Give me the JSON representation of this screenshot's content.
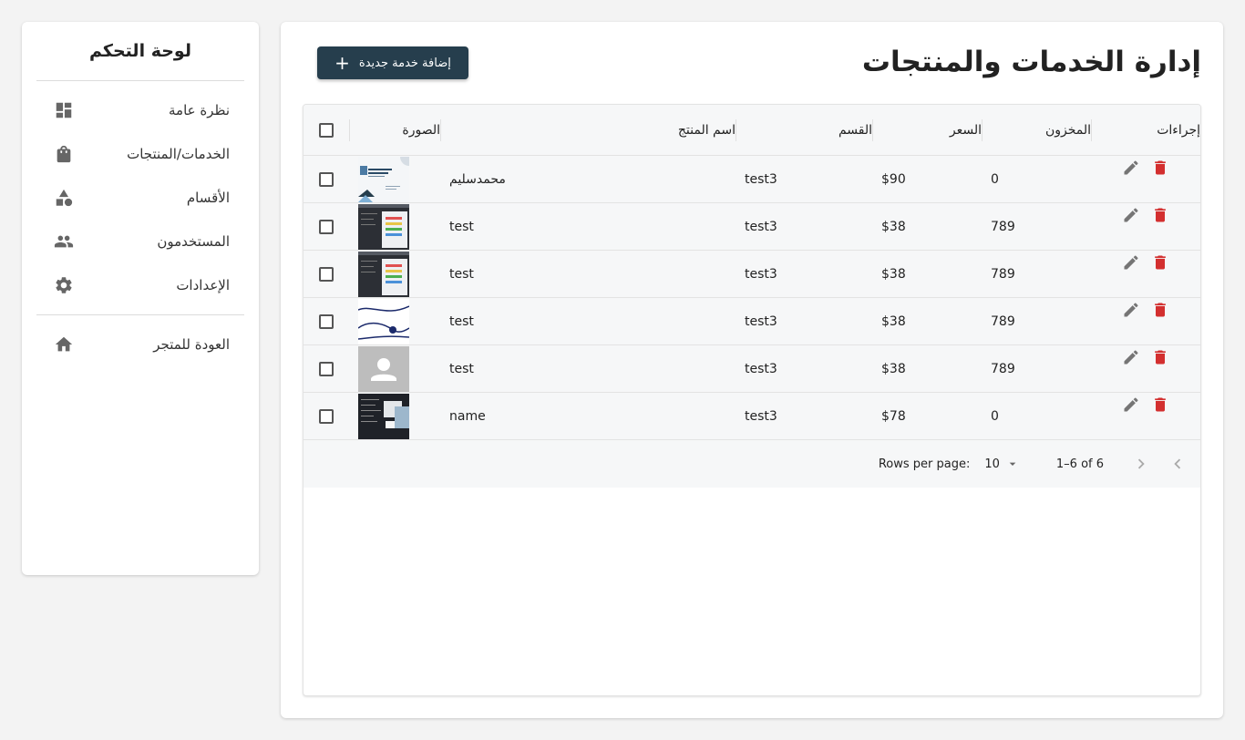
{
  "sidebar": {
    "title": "لوحة التحكم",
    "items": [
      {
        "label": "نظرة عامة",
        "icon": "dashboard-icon"
      },
      {
        "label": "الخدمات/المنتجات",
        "icon": "shopping-bag-icon"
      },
      {
        "label": "الأقسام",
        "icon": "category-icon"
      },
      {
        "label": "المستخدمون",
        "icon": "people-icon"
      },
      {
        "label": "الإعدادات",
        "icon": "gear-icon"
      }
    ],
    "back": {
      "label": "العودة للمتجر",
      "icon": "home-icon"
    }
  },
  "main": {
    "title": "إدارة الخدمات والمنتجات",
    "add_button": "إضافة خدمة جديدة",
    "add_button_icon": "+"
  },
  "table": {
    "headers": {
      "image": "الصورة",
      "name": "اسم المنتج",
      "category": "القسم",
      "price": "السعر",
      "stock": "المخزون",
      "actions": "إجراءات"
    },
    "rows": [
      {
        "name": "محمدسليم",
        "category": "test3",
        "price": "$90",
        "stock": "0",
        "thumb": "document-thumb"
      },
      {
        "name": "test",
        "category": "test3",
        "price": "$38",
        "stock": "789",
        "thumb": "dark-ui-thumb"
      },
      {
        "name": "test",
        "category": "test3",
        "price": "$38",
        "stock": "789",
        "thumb": "dark-ui-thumb"
      },
      {
        "name": "test",
        "category": "test3",
        "price": "$38",
        "stock": "789",
        "thumb": "line-diagram-thumb"
      },
      {
        "name": "test",
        "category": "test3",
        "price": "$38",
        "stock": "789",
        "thumb": "avatar-placeholder-thumb"
      },
      {
        "name": "name",
        "category": "test3",
        "price": "$78",
        "stock": "0",
        "thumb": "code-screenshot-thumb"
      }
    ]
  },
  "pagination": {
    "rows_per_page_label": "Rows per page:",
    "rows_per_page": "10",
    "range": "1–6 of 6"
  },
  "colors": {
    "button_bg": "#263e4d",
    "delete": "#d32f2f",
    "edit": "#757575"
  }
}
